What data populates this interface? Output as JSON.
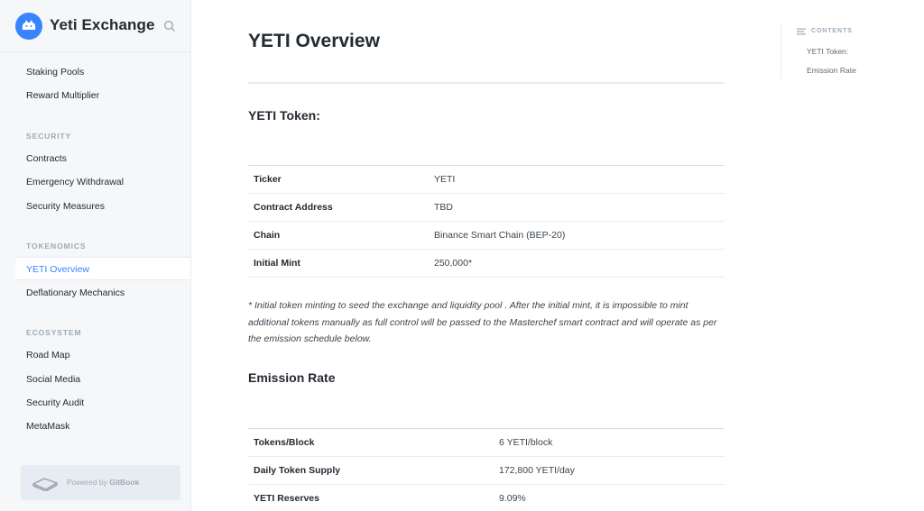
{
  "app": {
    "title": "Yeti Exchange"
  },
  "sidebar": {
    "items_top": [
      "Staking Pools",
      "Reward Multiplier"
    ],
    "sections": [
      {
        "title": "SECURITY",
        "items": [
          "Contracts",
          "Emergency Withdrawal",
          "Security Measures"
        ]
      },
      {
        "title": "TOKENOMICS",
        "items": [
          "YETI Overview",
          "Deflationary Mechanics"
        ]
      },
      {
        "title": "ECOSYSTEM",
        "items": [
          "Road Map",
          "Social Media",
          "Security Audit",
          "MetaMask"
        ]
      }
    ],
    "active_item": "YETI Overview",
    "powered_prefix": "Powered by ",
    "powered_brand": "GitBook"
  },
  "page": {
    "title": "YETI Overview",
    "token_heading": "YETI Token:",
    "token_table": [
      [
        "Ticker",
        "YETI"
      ],
      [
        "Contract Address",
        "TBD"
      ],
      [
        "Chain",
        "Binance Smart Chain (BEP-20)"
      ],
      [
        "Initial Mint",
        "250,000*"
      ]
    ],
    "note": "* Initial token minting to seed the exchange and liquidity pool .  After the initial mint, it is impossible to mint additional tokens manually as full control will be passed to the Masterchef smart contract and will operate as per the emission schedule below.",
    "emission_heading": "Emission Rate",
    "emission_table": [
      [
        "Tokens/Block",
        "6 YETI/block"
      ],
      [
        "Daily Token Supply",
        "172,800 YETI/day"
      ],
      [
        "YETI Reserves",
        "9.09%"
      ]
    ]
  },
  "toc": {
    "heading": "CONTENTS",
    "items": [
      "YETI Token:",
      "Emission Rate"
    ]
  },
  "colors": {
    "accent": "#3884ff",
    "sidebar_bg": "#f5f7f9",
    "text": "#242a31"
  }
}
